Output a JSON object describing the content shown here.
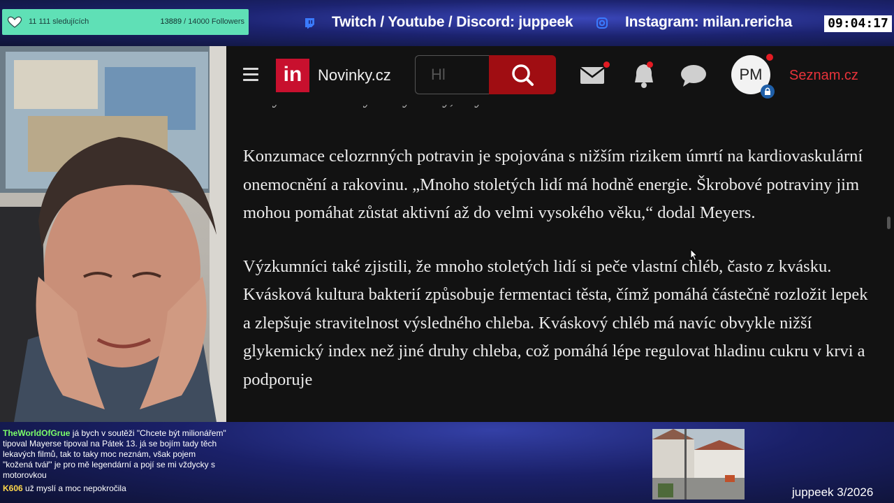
{
  "overlay": {
    "followers": {
      "label": "11 111 sledujících",
      "current": "13889",
      "goal_text": " / 14000 Followers",
      "progress": 0.992
    },
    "socials": {
      "twitch_text": "Twitch / Youtube / Discord: juppeek",
      "instagram_text": "Instagram: milan.rericha"
    },
    "clock": "09:04:17",
    "signature": "juppeek 3/2026"
  },
  "browser": {
    "site_name": "Novinky.cz",
    "logo_text": "in",
    "search_placeholder": "Hl",
    "avatar_initials": "PM",
    "seznam_link": "Seznam.cz",
    "article": {
      "cut_line": "s bílými rámovanými výrobky,“ vysvětlila Davisová.",
      "paragraphs": [
        "Konzumace celozrnných potravin je spojována s nižším rizikem úmrtí na kardiovaskulární onemocnění a rakovinu. „Mnoho stoletých lidí má hodně energie. Škrobové potraviny jim mohou pomáhat zůstat aktivní až do velmi vysokého věku,“ dodal Meyers.",
        "Výzkumníci také zjistili, že mnoho stoletých lidí si peče vlastní chléb, často z kvásku. Kvásková kultura bakterií způsobuje fermentaci těsta, čímž pomáhá částečně rozložit lepek a zlepšuje stravitelnost výsledného chleba. Kváskový chléb má navíc obvykle nižší glykemický index než jiné druhy chleba, což pomáhá lépe regulovat hladinu cukru v krvi a podporuje"
      ]
    }
  },
  "chat": [
    {
      "user": "TheWorldOfGrue",
      "user_color": "#7cff6a",
      "text": "já bych v soutěži \"Chcete být milionářem\" tipoval Mayerse tipoval na Pátek 13. já se bojím tady těch lekavých filmů, tak to taky moc neznám, však pojem \"kožená tvář\" je pro mě legendární a pojí se mi vždycky s motorovkou"
    },
    {
      "user": "K606",
      "user_color": "#ffd84a",
      "text": "už myslí a moc nepokročila"
    }
  ]
}
